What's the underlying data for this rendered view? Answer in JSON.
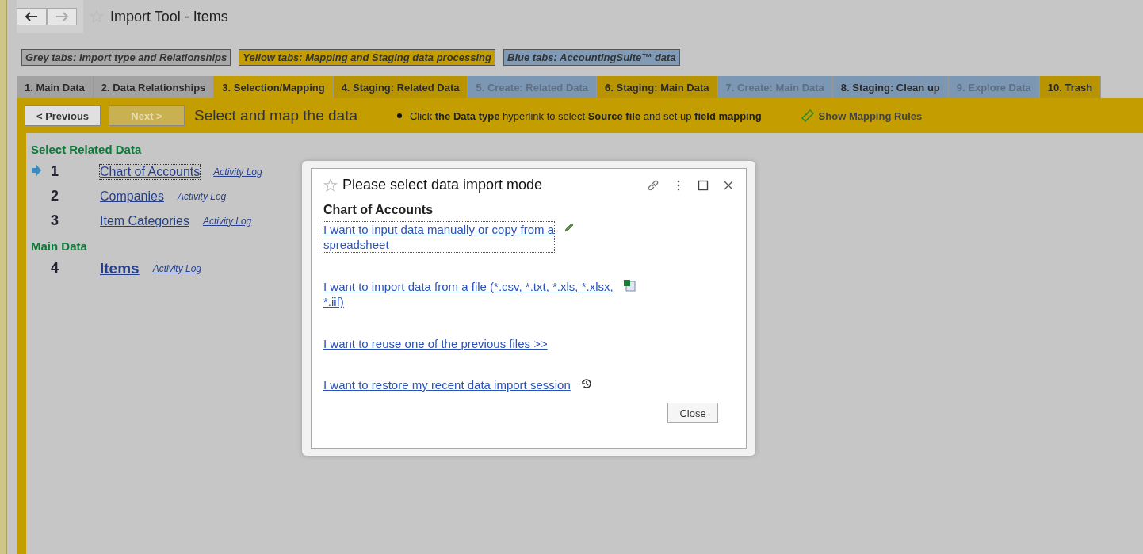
{
  "window": {
    "title": "Import Tool - Items"
  },
  "legend": [
    {
      "label": "Grey tabs: Import type and Relationships",
      "kind": "grey"
    },
    {
      "label": "Yellow tabs: Mapping and Staging data processing",
      "kind": "yellow"
    },
    {
      "label": "Blue tabs: AccountingSuite™ data",
      "kind": "blue"
    }
  ],
  "tabs": [
    {
      "label": "1. Main Data",
      "kind": "grey",
      "selected": false,
      "disabled": false
    },
    {
      "label": "2. Data Relationships",
      "kind": "grey",
      "selected": false,
      "disabled": false
    },
    {
      "label": "3. Selection/Mapping",
      "kind": "yellow",
      "selected": true,
      "disabled": false
    },
    {
      "label": "4. Staging: Related Data",
      "kind": "yellow",
      "selected": false,
      "disabled": false
    },
    {
      "label": "5. Create: Related Data",
      "kind": "blue",
      "selected": false,
      "disabled": true
    },
    {
      "label": "6. Staging: Main Data",
      "kind": "yellow",
      "selected": false,
      "disabled": false
    },
    {
      "label": "7. Create: Main Data",
      "kind": "blue",
      "selected": false,
      "disabled": true
    },
    {
      "label": "8. Staging: Clean up",
      "kind": "blue",
      "selected": false,
      "disabled": false
    },
    {
      "label": "9. Explore Data",
      "kind": "blue",
      "selected": false,
      "disabled": true
    },
    {
      "label": "10. Trash",
      "kind": "yellow",
      "selected": false,
      "disabled": false
    }
  ],
  "toolbar": {
    "previous": {
      "label": "< Previous",
      "disabled": false
    },
    "next": {
      "label": "Next >",
      "disabled": true
    },
    "heading": "Select and map the data",
    "hint": "Click **the Data type** hyperlink to select **Source file** and set up **field mapping**",
    "rules_link": "Show Mapping Rules"
  },
  "sections": [
    {
      "title": "Select Related Data",
      "items": [
        {
          "number": "1",
          "label": "Chart of Accounts",
          "log": "Activity Log",
          "current": true,
          "focused": true,
          "main": false
        },
        {
          "number": "2",
          "label": "Companies",
          "log": "Activity Log",
          "current": false,
          "focused": false,
          "main": false
        },
        {
          "number": "3",
          "label": "Item Categories",
          "log": "Activity Log",
          "current": false,
          "focused": false,
          "main": false
        }
      ]
    },
    {
      "title": "Main Data",
      "items": [
        {
          "number": "4",
          "label": "Items",
          "log": "Activity Log",
          "current": false,
          "focused": false,
          "main": true
        }
      ]
    }
  ],
  "dialog": {
    "title": "Please select data import mode",
    "subtitle": "Chart of Accounts",
    "options": [
      {
        "line1": "I want to input data manually or copy from a ",
        "line2": "spreadsheet",
        "kind": "pencil",
        "focused": true
      },
      {
        "line1": "I want to import data from a file (*.csv, *.txt, *.xls, *.xlsx, ",
        "line2": "*.iif)",
        "kind": "spreadsheet",
        "focused": false
      },
      {
        "line1": "I want to reuse one of the previous files  >>",
        "kind": "plain",
        "focused": false
      },
      {
        "line1": "I want to restore my recent data import session",
        "kind": "history",
        "focused": false
      }
    ],
    "close": "Close"
  }
}
